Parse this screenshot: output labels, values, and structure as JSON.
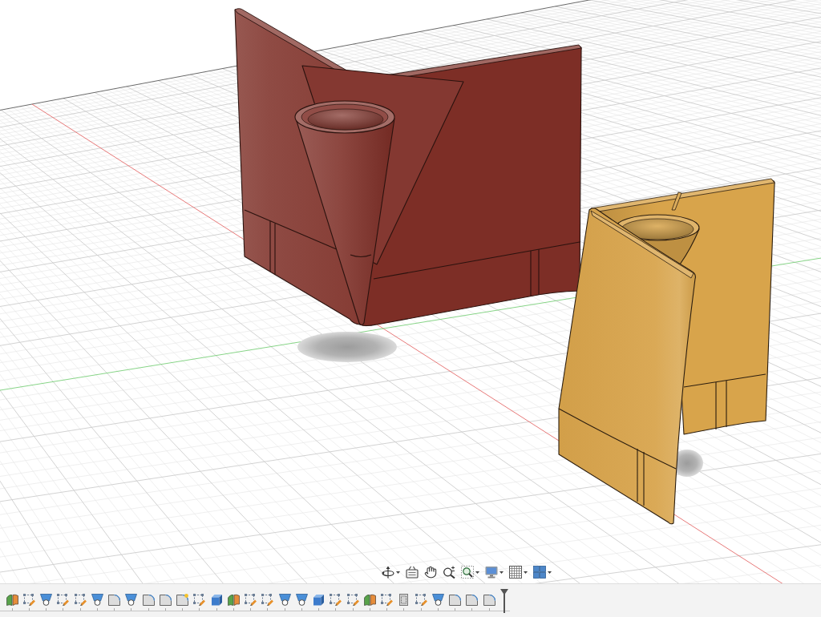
{
  "viewport": {
    "bodies": [
      {
        "color": "#7d2e26"
      },
      {
        "color": "#d8a44b"
      }
    ]
  },
  "navigation_bar": [
    {
      "kind": "orbit",
      "menu": true
    },
    {
      "kind": "look_at",
      "menu": false
    },
    {
      "kind": "pan",
      "menu": false
    },
    {
      "kind": "zoom",
      "menu": false
    },
    {
      "kind": "zoom_window",
      "menu": true
    },
    {
      "kind": "display",
      "menu": true
    },
    {
      "kind": "grid",
      "menu": true
    },
    {
      "kind": "viewports",
      "menu": true
    }
  ],
  "timeline": {
    "features": [
      {
        "kind": "split"
      },
      {
        "kind": "sketch"
      },
      {
        "kind": "hole"
      },
      {
        "kind": "sketch"
      },
      {
        "kind": "sketch"
      },
      {
        "kind": "hole"
      },
      {
        "kind": "fillet"
      },
      {
        "kind": "hole"
      },
      {
        "kind": "fillet"
      },
      {
        "kind": "fillet"
      },
      {
        "kind": "rulefillet"
      },
      {
        "kind": "sketch"
      },
      {
        "kind": "extrude"
      },
      {
        "kind": "split"
      },
      {
        "kind": "sketch"
      },
      {
        "kind": "sketch"
      },
      {
        "kind": "hole"
      },
      {
        "kind": "hole"
      },
      {
        "kind": "extrude"
      },
      {
        "kind": "sketch"
      },
      {
        "kind": "sketch"
      },
      {
        "kind": "split"
      },
      {
        "kind": "sketch"
      },
      {
        "kind": "shell"
      },
      {
        "kind": "sketch"
      },
      {
        "kind": "hole"
      },
      {
        "kind": "fillet"
      },
      {
        "kind": "fillet"
      },
      {
        "kind": "fillet"
      }
    ]
  }
}
